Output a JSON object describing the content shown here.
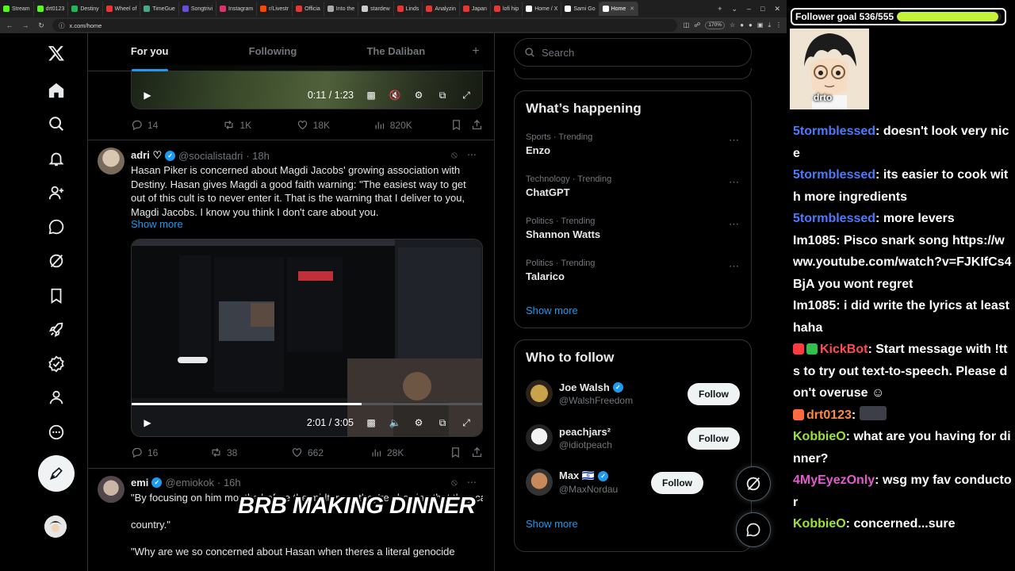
{
  "browser": {
    "tabs": [
      {
        "label": "Stream"
      },
      {
        "label": "drt0123"
      },
      {
        "label": "Destiny"
      },
      {
        "label": "Wheel of"
      },
      {
        "label": "TimeGue"
      },
      {
        "label": "Songtrivi"
      },
      {
        "label": "Instagram"
      },
      {
        "label": "r/Livestr"
      },
      {
        "label": "Officia"
      },
      {
        "label": "Into the"
      },
      {
        "label": "stardew"
      },
      {
        "label": "Linds"
      },
      {
        "label": "Analyzin"
      },
      {
        "label": "Japan"
      },
      {
        "label": "lofi hip"
      },
      {
        "label": "Home / X"
      },
      {
        "label": "Sami Go"
      },
      {
        "label": "Home"
      }
    ],
    "active_tab": "Home",
    "url": "x.com/home",
    "zoom": "170%"
  },
  "timeline": {
    "tabs": [
      "For you",
      "Following",
      "The Daliban"
    ],
    "plus": "+",
    "tweet0": {
      "video_time": "0:11 / 1:23",
      "replies": "14",
      "reposts": "1K",
      "likes": "18K",
      "views": "820K"
    },
    "tweet1": {
      "name": "adri ♡",
      "handle": "@socialistadri",
      "time": "· 18h",
      "text": "Hasan Piker is concerned about Magdi Jacobs' growing association with Destiny. Hasan gives Magdi a good faith warning: \"The easiest way to get out of this cult is to never enter it. That is the warning that I deliver to you, Magdi Jacobs. I know you think I don't care about you.",
      "show_more": "Show more",
      "video_time": "2:01 / 3:05",
      "replies": "16",
      "reposts": "38",
      "likes": "662",
      "views": "28K"
    },
    "tweet2": {
      "name": "emi",
      "handle": "@emiokok",
      "time": "· 16h",
      "text1": "\"By focusing on him months before the midterms, they're showing that they care more about protec",
      "text1b": "country.\"",
      "text2": "\"Why are we so concerned about Hasan when theres a literal genocide"
    }
  },
  "overlay_text": "BRB MAKING DINNER",
  "right": {
    "search_placeholder": "Search",
    "happening": {
      "title": "What’s happening",
      "trends": [
        {
          "meta": "Sports · Trending",
          "name": "Enzo"
        },
        {
          "meta": "Technology · Trending",
          "name": "ChatGPT"
        },
        {
          "meta": "Politics · Trending",
          "name": "Shannon Watts"
        },
        {
          "meta": "Politics · Trending",
          "name": "Talarico"
        }
      ],
      "show_more": "Show more"
    },
    "who_to_follow": {
      "title": "Who to follow",
      "users": [
        {
          "name": "Joe Walsh",
          "handle": "@WalshFreedom",
          "button": "Follow"
        },
        {
          "name": "peachjars²",
          "handle": "@idiotpeach",
          "button": "Follow"
        },
        {
          "name": "Max 🇮🇱",
          "handle": "@MaxNordau",
          "button": "Follow"
        }
      ],
      "show_more": "Show more"
    }
  },
  "stream": {
    "goal_label": "Follower goal 536/555",
    "goal_progress": 0.966,
    "cam_tag": "drto",
    "chat": [
      {
        "user": "5tormblessed",
        "color": "#4a7bff",
        "text": "doesn't look very nice",
        "clip": true
      },
      {
        "user": "5tormblessed",
        "color": "#4a7bff",
        "text": "its easier to cook with more ingredients"
      },
      {
        "user": "5tormblessed",
        "color": "#4a7bff",
        "text": "more levers"
      },
      {
        "user": "Im1085",
        "color": "#ffffff",
        "text": "Pisco snark song https://www.youtube.com/watch?v=FJKIfCs4BjA you wont regret"
      },
      {
        "user": "Im1085",
        "color": "#ffffff",
        "text": "i did write the lyrics at least haha"
      },
      {
        "user": "KickBot",
        "color": "#ff4d4d",
        "text": "Start message with !tts to try out text-to-speech. Please don't overuse ☺",
        "badges": true
      },
      {
        "user": "drt0123",
        "color": "#ff8a3d",
        "text": "",
        "badge_single": true
      },
      {
        "user": "KobbieO",
        "color": "#9be23a",
        "text": "what are you having for dinner?"
      },
      {
        "user": "4MyEyezOnly",
        "color": "#e45ad0",
        "text": "wsg my fav conductor"
      },
      {
        "user": "KobbieO",
        "color": "#9be23a",
        "text": "concerned...sure"
      }
    ]
  }
}
